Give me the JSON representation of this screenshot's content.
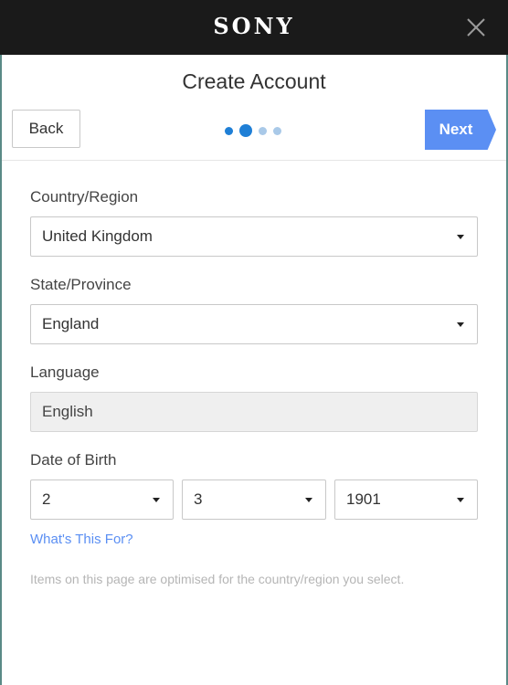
{
  "header": {
    "logo_text": "SONY",
    "close_icon": "close-icon"
  },
  "title": "Create Account",
  "nav": {
    "back_label": "Back",
    "next_label": "Next",
    "step_current": 2,
    "step_total": 4
  },
  "form": {
    "country": {
      "label": "Country/Region",
      "value": "United Kingdom"
    },
    "state": {
      "label": "State/Province",
      "value": "England"
    },
    "language": {
      "label": "Language",
      "value": "English"
    },
    "dob": {
      "label": "Date of Birth",
      "day": "2",
      "month": "3",
      "year": "1901"
    }
  },
  "help_link": "What's This For?",
  "note": "Items on this page are optimised for the country/region you select.",
  "colors": {
    "accent": "#5b8ff3",
    "step_active": "#1f7fd6",
    "step_inactive": "#a9c9e8",
    "topbar": "#1a1a1a"
  }
}
